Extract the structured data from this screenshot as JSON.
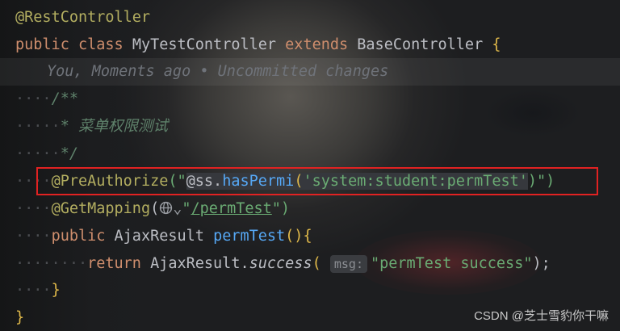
{
  "code": {
    "l1": "@RestController",
    "l2_kw1": "public",
    "l2_kw2": "class",
    "l2_name": "MyTestController",
    "l2_kw3": "extends",
    "l2_parent": "BaseController",
    "l2_brace": "{",
    "blame": "You, Moments ago • Uncommitted changes",
    "c_open": "/**",
    "c_text": "* 菜单权限测试",
    "c_close": "*/",
    "pre_ann": "@PreAuthorize",
    "pre_open": "(\"",
    "pre_at": "@ss.",
    "pre_fn": "hasPermi",
    "pre_p": "(",
    "pre_arg": "'system:student:permTest'",
    "pre_close": ")\")",
    "get_ann": "@GetMapping",
    "get_open": "(",
    "get_q": "\"",
    "get_path": "/permTest",
    "get_close": "\")",
    "m_kw": "public",
    "m_type": "AjaxResult",
    "m_name": "permTest",
    "m_rest": "(){",
    "r_kw": "return",
    "r_cls": "AjaxResult.",
    "r_fn": "success",
    "r_open": "(",
    "r_hint": "msg:",
    "r_str": "\"permTest success\"",
    "r_close": ");",
    "close_inner": "}",
    "close_outer": "}"
  },
  "watermark": "CSDN @芝士雪豹你干嘛"
}
